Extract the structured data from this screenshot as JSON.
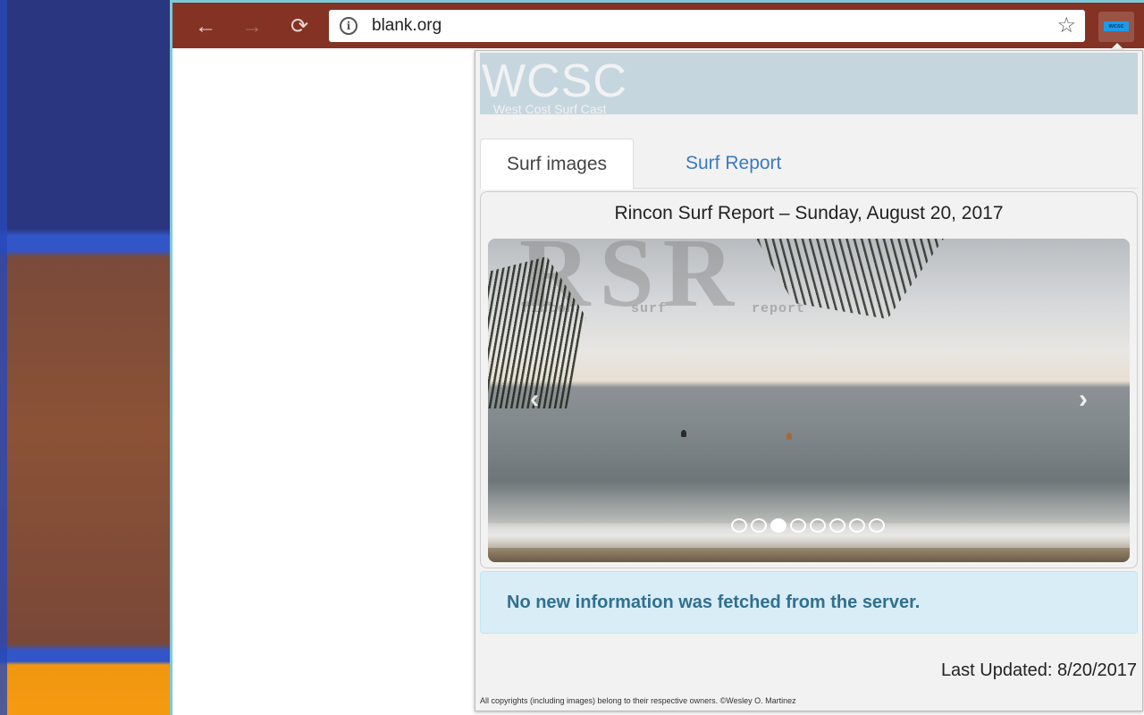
{
  "browser": {
    "url": "blank.org",
    "back_icon": "←",
    "forward_icon": "→",
    "reload_icon": "⟳",
    "info_icon": "i",
    "star_icon": "☆",
    "extension_badge": "wcsc"
  },
  "popup": {
    "header": {
      "title": "WCSC",
      "subtitle": "West Cost Surf Cast"
    },
    "tabs": [
      {
        "label": "Surf images",
        "active": true
      },
      {
        "label": "Surf Report",
        "active": false
      }
    ],
    "report_title": "Rincon Surf Report – Sunday, August 20, 2017",
    "carousel": {
      "watermark": "RSR",
      "watermark_words": [
        "rincon",
        "surf",
        "report"
      ],
      "prev_icon": "‹",
      "next_icon": "›",
      "slide_count": 8,
      "active_index": 2
    },
    "alert": "No new information was fetched from the server.",
    "last_updated": "Last Updated: 8/20/2017",
    "copyright": "All copyrights (including images) belong to their respective owners. ©Wesley O. Martinez"
  },
  "colors": {
    "toolbar": "#833224",
    "link": "#3a7abf",
    "alert_bg": "#d9edf7",
    "alert_text": "#31708f",
    "header_bg": "#c5d6df"
  }
}
